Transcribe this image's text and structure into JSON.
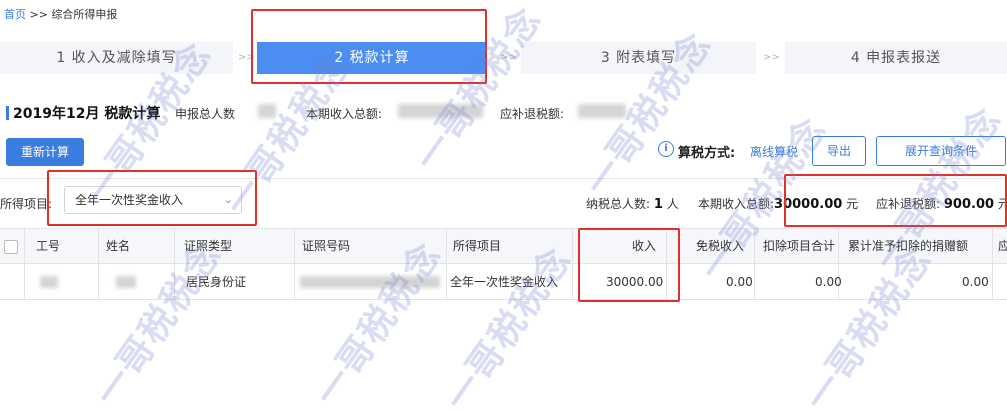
{
  "breadcrumb": {
    "home": "首页",
    "sep": ">>",
    "current": "综合所得申报"
  },
  "steps": [
    {
      "label": "1 收入及减除填写"
    },
    {
      "label": "2 税款计算"
    },
    {
      "label": "3 附表填写"
    },
    {
      "label": "4 申报表报送"
    }
  ],
  "step_sep": ">>",
  "summary": {
    "period": "2019年12月",
    "title": "税款计算",
    "declarants_label": "申报总人数",
    "income_label": "本期收入总额:",
    "tax_label": "应补退税额:"
  },
  "buttons": {
    "recalc": "重新计算",
    "export": "导出",
    "expand": "展开查询条件"
  },
  "calc_method": {
    "label": "算税方式:",
    "value": "离线算税"
  },
  "filter": {
    "label": "所得项目:",
    "selected": "全年一次性奖金收入"
  },
  "stats": {
    "people_label": "纳税总人数:",
    "people_value": "1",
    "people_unit": "人",
    "income_label": "本期收入总额:",
    "income_value": "30000.00",
    "income_unit": "元",
    "tax_label": "应补退税额:",
    "tax_value": "900.00",
    "tax_unit": "元"
  },
  "table": {
    "headers": [
      "工号",
      "姓名",
      "证照类型",
      "证照号码",
      "所得项目",
      "收入",
      "免税收入",
      "扣除项目合计",
      "累计准予扣除的捐赠额",
      "应"
    ],
    "rows": [
      {
        "id_type": "居民身份证",
        "income_item": "全年一次性奖金收入",
        "income": "30000.00",
        "tax_free": "0.00",
        "deductions": "0.00",
        "donation": "0.00"
      }
    ]
  },
  "watermark": "一哥税税念",
  "colors": {
    "accent": "#3a7de1",
    "active_step": "#4b8df0",
    "annotation_red": "#e0302a"
  }
}
